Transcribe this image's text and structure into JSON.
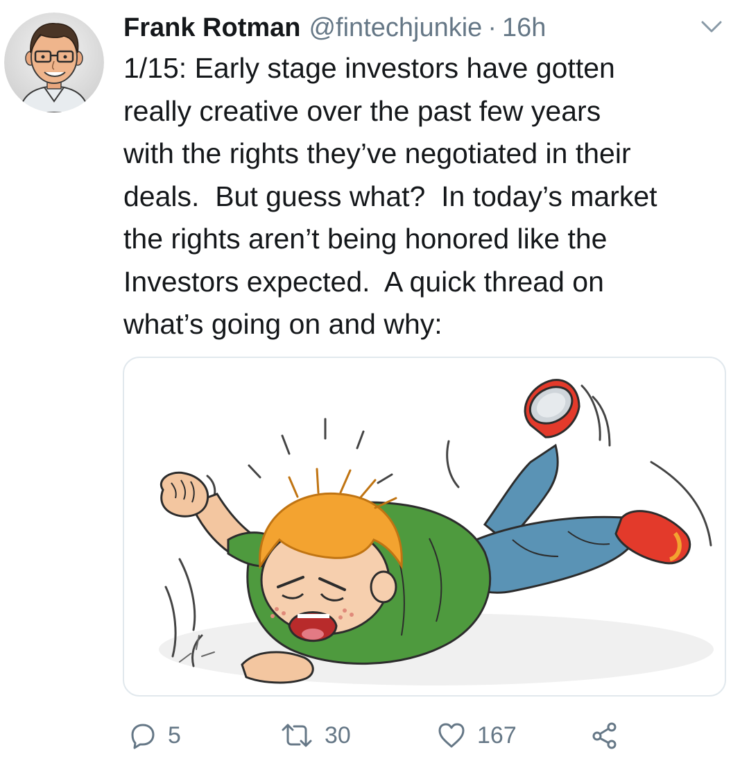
{
  "tweet": {
    "author": {
      "name": "Frank Rotman",
      "handle": "@fintechjunkie",
      "avatar_icon": "cartoon-man-avatar"
    },
    "separator": "·",
    "time": "16h",
    "menu_icon": "chevron-down-icon",
    "text": "1/15: Early stage investors have gotten\nreally creative over the past few years\nwith the rights they’ve negotiated in their\ndeals.  But guess what?  In today’s market\nthe rights aren’t being honored like the\nInvestors expected.  A quick thread on\nwhat’s going on and why:",
    "media": {
      "type": "image",
      "icon": "cartoon-tantrum-illustration"
    },
    "actions": {
      "reply": {
        "icon": "reply-icon",
        "count": "5"
      },
      "retweet": {
        "icon": "retweet-icon",
        "count": "30"
      },
      "like": {
        "icon": "heart-icon",
        "count": "167"
      },
      "share": {
        "icon": "share-icon"
      }
    }
  },
  "colors": {
    "text_primary": "#14171a",
    "text_secondary": "#657786",
    "border": "#e1e8ed"
  }
}
